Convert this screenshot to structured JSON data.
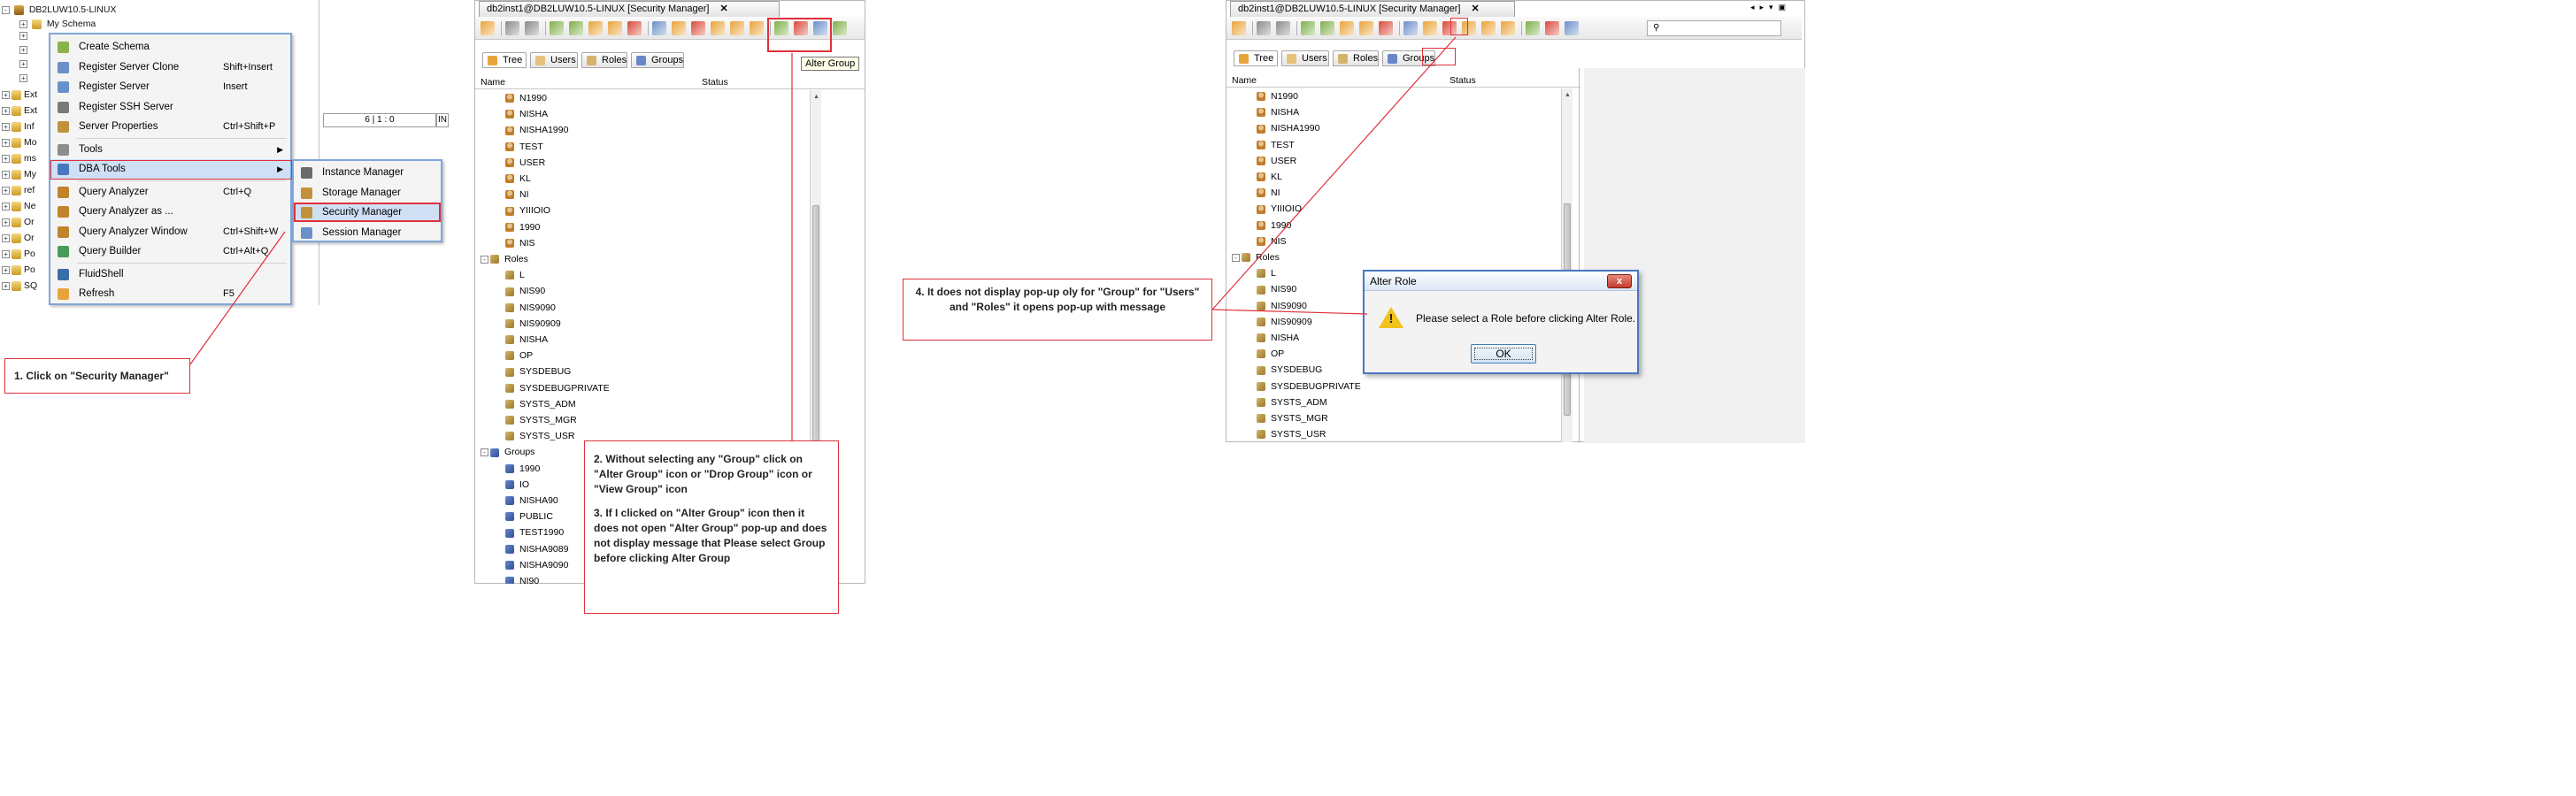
{
  "left_tree": {
    "root_label": "DB2LUW10.5-LINUX",
    "schema_label": "My Schema",
    "truncated_items": [
      "Ext",
      "Ext",
      "Inf",
      "Mo",
      "ms",
      "My",
      "ref",
      "Ne",
      "Or",
      "Or",
      "Po",
      "Po",
      "SQ"
    ]
  },
  "status_cells": {
    "position": "6 | 1 : 0",
    "mode": "IN"
  },
  "context_menu": {
    "items": [
      {
        "label": "Create Schema",
        "shortcut": "",
        "icon": "create-schema-icon"
      },
      {
        "label": "Register Server Clone",
        "shortcut": "Shift+Insert",
        "icon": "register-clone-icon"
      },
      {
        "label": "Register Server",
        "shortcut": "Insert",
        "icon": "register-server-icon"
      },
      {
        "label": "Register SSH Server",
        "shortcut": "",
        "icon": "ssh-server-icon"
      },
      {
        "label": "Server Properties",
        "shortcut": "Ctrl+Shift+P",
        "icon": "properties-icon"
      },
      {
        "label": "Tools",
        "shortcut": "",
        "icon": "tools-icon"
      },
      {
        "label": "DBA Tools",
        "shortcut": "",
        "icon": "dba-tools-icon"
      },
      {
        "label": "Query Analyzer",
        "shortcut": "Ctrl+Q",
        "icon": "query-analyzer-icon"
      },
      {
        "label": "Query Analyzer as ...",
        "shortcut": "",
        "icon": "query-analyzer-as-icon"
      },
      {
        "label": "Query Analyzer Window",
        "shortcut": "Ctrl+Shift+W",
        "icon": "query-window-icon"
      },
      {
        "label": "Query Builder",
        "shortcut": "Ctrl+Alt+Q",
        "icon": "query-builder-icon"
      },
      {
        "label": "FluidShell",
        "shortcut": "",
        "icon": "fluidshell-icon"
      },
      {
        "label": "Refresh",
        "shortcut": "F5",
        "icon": "refresh-icon"
      }
    ]
  },
  "dba_submenu": {
    "items": [
      {
        "label": "Instance Manager",
        "icon": "instance-manager-icon"
      },
      {
        "label": "Storage Manager",
        "icon": "storage-manager-icon"
      },
      {
        "label": "Security Manager",
        "icon": "security-manager-icon"
      },
      {
        "label": "Session Manager",
        "icon": "session-manager-icon"
      }
    ]
  },
  "editor_tab_title": "db2inst1@DB2LUW10.5-LINUX [Security Manager]",
  "view_tabs": [
    "Tree",
    "Users",
    "Roles",
    "Groups"
  ],
  "columns": {
    "name": "Name",
    "status": "Status"
  },
  "tooltip": "Alter Group",
  "panel1": {
    "users": [
      "N1990",
      "NISHA",
      "NISHA1990",
      "TEST",
      "USER",
      "KL",
      "NI",
      "YIIIOIO",
      "1990",
      "NIS"
    ],
    "roles_header": "Roles",
    "roles": [
      "L",
      "NIS90",
      "NIS9090",
      "NIS90909",
      "NISHA",
      "OP",
      "SYSDEBUG",
      "SYSDEBUGPRIVATE",
      "SYSTS_ADM",
      "SYSTS_MGR",
      "SYSTS_USR"
    ],
    "groups_header": "Groups",
    "groups": [
      "1990",
      "IO",
      "NISHA90",
      "PUBLIC",
      "TEST1990",
      "NISHA9089",
      "NISHA9090",
      "NI90"
    ]
  },
  "panel2": {
    "users": [
      "N1990",
      "NISHA",
      "NISHA1990",
      "TEST",
      "USER",
      "KL",
      "NI",
      "YIIIOIO",
      "1990",
      "NIS"
    ],
    "roles_header": "Roles",
    "roles": [
      "L",
      "NIS90",
      "NIS9090",
      "NIS90909",
      "NISHA",
      "OP",
      "SYSDEBUG",
      "SYSDEBUGPRIVATE",
      "SYSTS_ADM",
      "SYSTS_MGR",
      "SYSTS_USR"
    ]
  },
  "dialog": {
    "title": "Alter Role",
    "close_label": "x",
    "message": "Please select a Role before clicking Alter Role.",
    "ok_label": "OK"
  },
  "notes": {
    "step1": "1. Click on \"Security Manager\"",
    "step2": "2. Without selecting any \"Group\" click on \"Alter Group\" icon  or \"Drop Group\" icon or \"View Group\" icon",
    "step3": "3. If I clicked on \"Alter Group\" icon then it does not open \"Alter Group\" pop-up and does not display message that Please select Group before clicking Alter Group",
    "step4": "4. It does not display pop-up oly for \"Group\" for \"Users\" and \"Roles\" it opens pop-up with message"
  },
  "colors": {
    "annotation_red": "#e0303a",
    "menu_border": "#7fa6d8",
    "dialog_border": "#4a78c0"
  }
}
